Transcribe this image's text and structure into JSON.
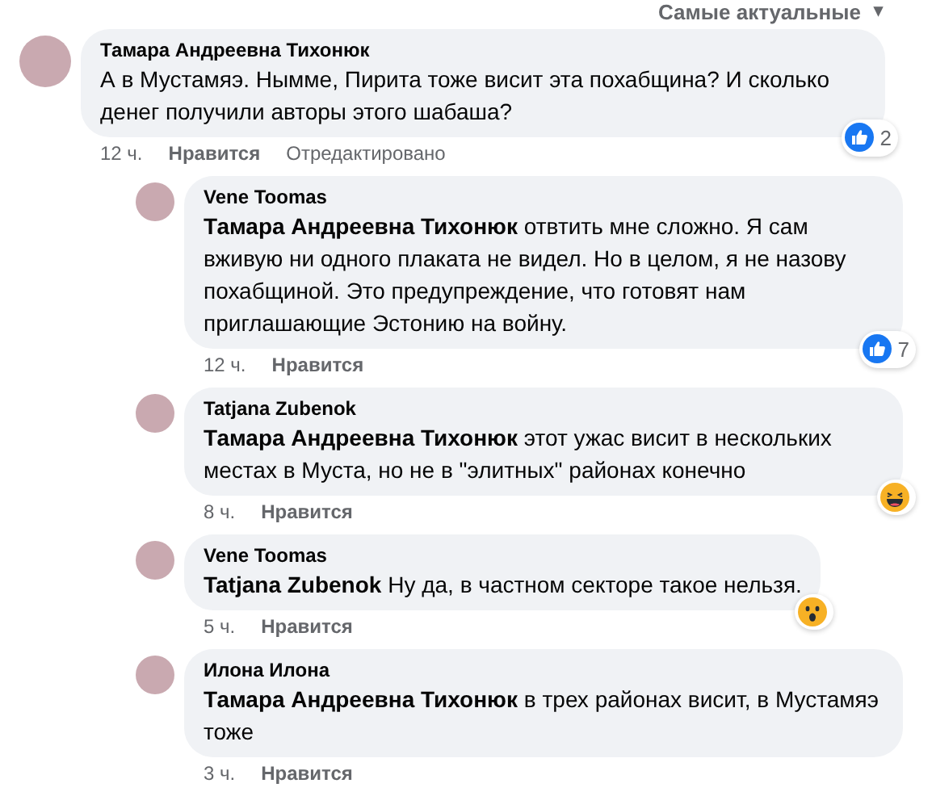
{
  "sort_menu": {
    "label": "Самые актуальные",
    "caret": "▾"
  },
  "comment": {
    "author": "Тамара Андреевна Тихонюк",
    "text": "А в Мустамяэ. Нымме, Пирита тоже висит эта похабщина? И сколько денег получили авторы этого шабаша?",
    "time": "12 ч.",
    "like_label": "Нравится",
    "edited": "Отредактировано",
    "reaction": {
      "kind": "like",
      "count": "2"
    }
  },
  "replies": [
    {
      "author": "Vene Toomas",
      "text": "**Тамара Андреевна Тихонюк** отвтить мне сложно. Я сам вживую ни одного плаката не видел. Но в целом, я не назову похабщиной. Это предупреждение, что готовят нам приглашающие Эстонию на войну.",
      "time": "12 ч.",
      "like_label": "Нравится",
      "reaction": {
        "kind": "like",
        "count": "7"
      }
    },
    {
      "author": "Tatjana Zubenok",
      "text": "**Тамара Андреевна Тихонюк** этот ужас висит в нескольких местах в Муста, но не в \"элитных\" районах конечно",
      "time": "8 ч.",
      "like_label": "Нравится",
      "reaction": {
        "kind": "haha"
      }
    },
    {
      "author": "Vene Toomas",
      "text": "**Tatjana Zubenok** Ну да, в частном секторе такое нельзя.",
      "time": "5 ч.",
      "like_label": "Нравится",
      "reaction": {
        "kind": "wow"
      }
    },
    {
      "author": "Илона Илона",
      "text": "**Тамара Андреевна Тихонюк** в трех районах висит, в Мустамяэ тоже",
      "time": "3 ч.",
      "like_label": "Нравится"
    }
  ]
}
